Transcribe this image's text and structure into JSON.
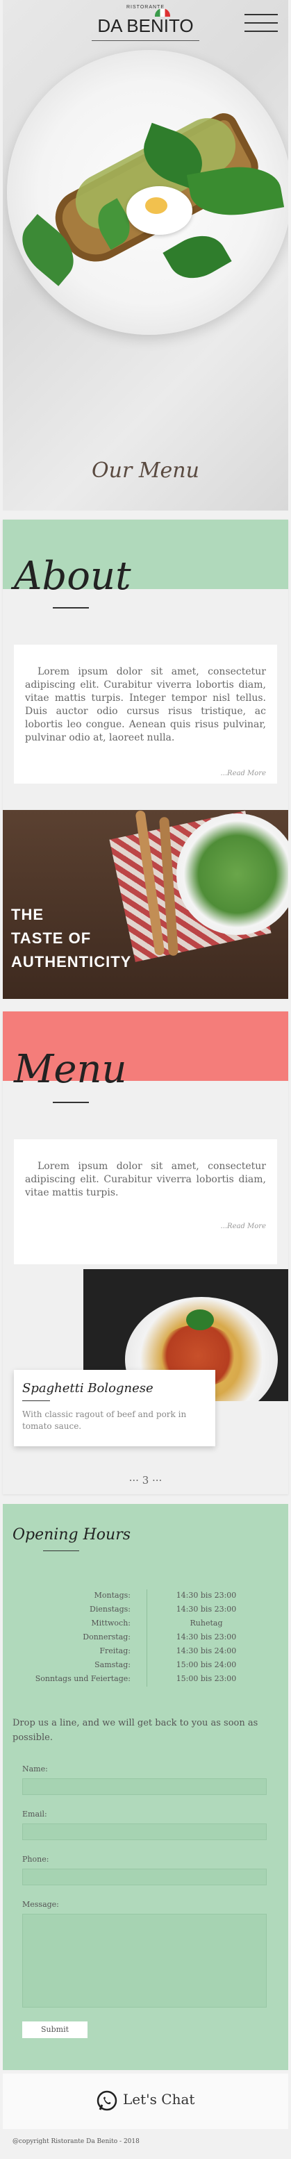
{
  "header": {
    "brand_small": "RISTORANTE",
    "brand": "DA BENITO",
    "hero_title": "Our Menu"
  },
  "about": {
    "title": "About",
    "text": "Lorem ipsum dolor sit amet, consectetur adipiscing elit. Curabitur viverra lobortis diam, vitae mattis turpis. Integer tempor nisl tellus. Duis auctor odio cursus risus tristique, ac lobortis leo congue. Aenean quis risus pulvinar, pulvinar odio at, laoreet nulla.",
    "read_more": "...Read More"
  },
  "taste": {
    "line1": "THE",
    "line2": "TASTE OF",
    "line3": "AUTHENTICITY"
  },
  "menu": {
    "title": "Menu",
    "text": "Lorem ipsum dolor sit amet, consectetur adipiscing elit. Curabitur viverra lobortis diam, vitae mattis turpis.",
    "read_more": "...Read More",
    "dish_name": "Spaghetti Bolognese",
    "dish_desc": "With classic ragout of beef and pork in tomato sauce.",
    "pager": "··· 3 ···"
  },
  "hours": {
    "title": "Opening Hours",
    "rows": [
      {
        "day": "Montags:",
        "time": "14:30 bis 23:00"
      },
      {
        "day": "Dienstags:",
        "time": "14:30 bis 23:00"
      },
      {
        "day": "Mittwoch:",
        "time": "Ruhetag"
      },
      {
        "day": "Donnerstag:",
        "time": "14:30 bis 23:00"
      },
      {
        "day": "Freitag:",
        "time": "14:30 bis 24:00"
      },
      {
        "day": "Samstag:",
        "time": "15:00 bis 24:00"
      },
      {
        "day": "Sonntags und Feiertage:",
        "time": "15:00 bis 23:00"
      }
    ]
  },
  "contact": {
    "intro": "Drop us a line, and we will get back to you as soon as possible.",
    "name_label": "Name:",
    "email_label": "Email:",
    "phone_label": "Phone:",
    "message_label": "Message:",
    "submit": "Submit"
  },
  "chat": {
    "label": "Let's Chat"
  },
  "footer": {
    "copyright": "@copyright Ristorante Da Benito - 2018"
  },
  "colors": {
    "green": "#b0d9bb",
    "red": "#f47d7a"
  }
}
